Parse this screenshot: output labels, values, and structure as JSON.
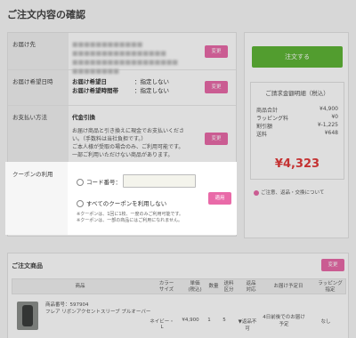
{
  "page_title": "ご注文内容の確認",
  "change_label": "変更",
  "delivery": {
    "label": "お届け先",
    "blurred_lines": [
      "■■■■■■■■■■■■",
      "■■■■■■■■■■■■■■■■",
      "■■■■■■■■■■■■■■■■■■",
      "■■■■■■■■"
    ]
  },
  "delivery_date": {
    "label": "お届け希望日時",
    "items": [
      {
        "term": "お届け希望日",
        "value": "：指定しない"
      },
      {
        "term": "お届け希望時間帯",
        "value": "：指定しない"
      }
    ]
  },
  "payment": {
    "label": "お支払い方法",
    "method": "代金引換",
    "lines": [
      "お届け商品と引き換えに現金でお支払いくださ",
      "い。（手数料は当社負担です。）",
      "ご本人様が受取の場合のみ、ご利用可能です。",
      "一部ご利用いただけない商品があります。"
    ]
  },
  "coupon": {
    "label": "クーポンの利用",
    "code_option": "コード番号：",
    "no_coupon_option": "すべてのクーポンを利用しない",
    "apply_label": "適用",
    "notes": [
      "※クーポンは、1回に1枚、一度のみご利用可能です。",
      "※クーポンは、一部の商品にはご利用になれません。"
    ]
  },
  "summary": {
    "order_button": "注文する",
    "title": "ご請求金額明細（税込）",
    "rows": [
      {
        "label": "商品合計",
        "value": "¥4,900"
      },
      {
        "label": "ラッピング料",
        "value": "¥0"
      },
      {
        "label": "割引額",
        "value": "¥-1,225"
      },
      {
        "label": "送料",
        "value": "¥648"
      }
    ],
    "total": "¥4,323",
    "notice": "ご注意、返品・交換について"
  },
  "products": {
    "title": "ご注文商品",
    "headers": {
      "product": "商品",
      "color_size": "カラー\nサイズ",
      "price": "単価\n(税込)",
      "qty": "数量",
      "shipping": "送料\n区分",
      "returns": "返品\n対応",
      "delivery_date": "お届け予定日",
      "wrapping": "ラッピング\n指定"
    },
    "row": {
      "code": "商品番号：597904",
      "name": "フレア リボンアクセントスリーブ プルオーバー",
      "color_size": "ネイビー・L",
      "price": "¥4,900",
      "qty": "1",
      "shipping": "5",
      "returns": "▼返品不可",
      "delivery_date": "4日前後でのお届け予定",
      "wrapping": "なし"
    }
  }
}
